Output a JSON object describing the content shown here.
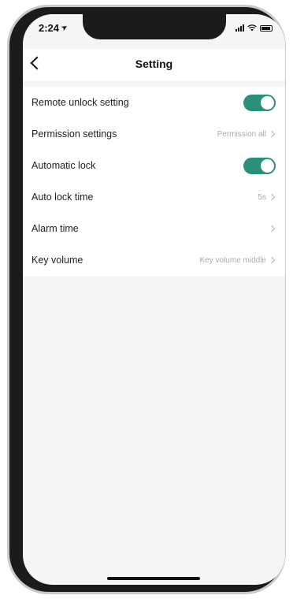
{
  "status_bar": {
    "time": "2:24",
    "location_icon": "location-arrow-icon",
    "signal_icon": "signal-icon",
    "wifi_icon": "wifi-icon",
    "battery_icon": "battery-icon"
  },
  "header": {
    "title": "Setting",
    "back_icon": "chevron-left-icon"
  },
  "settings": [
    {
      "label": "Remote unlock setting",
      "type": "toggle",
      "on": true
    },
    {
      "label": "Permission settings",
      "type": "value",
      "value": "Permission all"
    },
    {
      "label": "Automatic lock",
      "type": "toggle",
      "on": true
    },
    {
      "label": "Auto lock time",
      "type": "value",
      "value": "5s"
    },
    {
      "label": "Alarm time",
      "type": "value",
      "value": ""
    },
    {
      "label": "Key volume",
      "type": "value",
      "value": "Key volume middle"
    }
  ],
  "colors": {
    "toggle_on": "#2c8f7c",
    "value_text": "#aaaaaa"
  }
}
